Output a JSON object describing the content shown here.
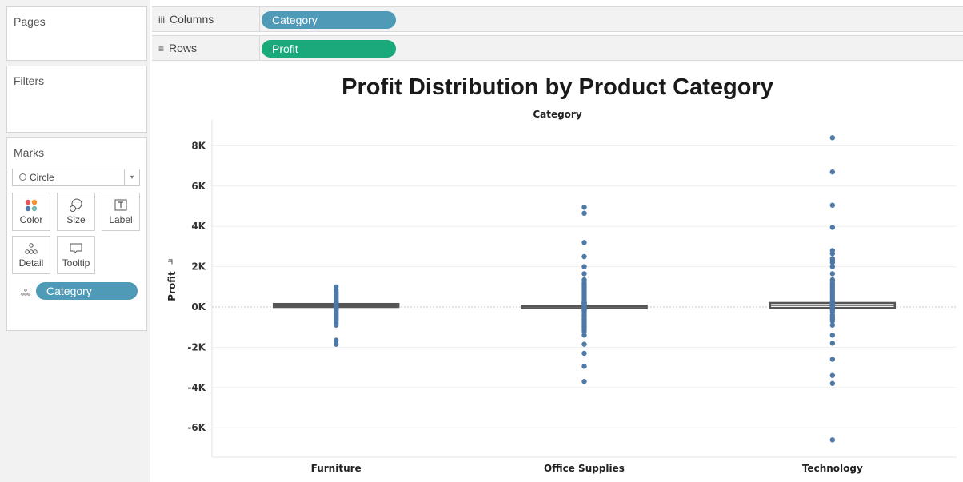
{
  "shelves": {
    "pages": "Pages",
    "filters": "Filters",
    "columns_label": "Columns",
    "rows_label": "Rows",
    "columns_pill": "Category",
    "rows_pill": "Profit",
    "columns_icon": "columns-icon",
    "rows_icon": "rows-icon"
  },
  "marks": {
    "title": "Marks",
    "type": "Circle",
    "buttons": {
      "color": "Color",
      "size": "Size",
      "label": "Label",
      "detail": "Detail",
      "tooltip": "Tooltip"
    },
    "detail_pill": "Category"
  },
  "colors": {
    "dimension_pill": "#4e9ab7",
    "measure_pill": "#1aa97a",
    "dot": "#4e79a7",
    "box": "#555555"
  },
  "chart_data": {
    "type": "scatter",
    "title": "Profit Distribution by Product Category",
    "column_header": "Category",
    "ylabel": "Profit",
    "categories": [
      "Furniture",
      "Office Supplies",
      "Technology"
    ],
    "yticks": [
      8000,
      6000,
      4000,
      2000,
      0,
      -2000,
      -4000,
      -6000
    ],
    "ytick_labels": [
      "8K",
      "6K",
      "4K",
      "2K",
      "0K",
      "-2K",
      "-4K",
      "-6K"
    ],
    "ylim": [
      -7500,
      8500
    ],
    "grid": true,
    "box": [
      {
        "category": "Furniture",
        "q1": 0,
        "median": 50,
        "q3": 150
      },
      {
        "category": "Office Supplies",
        "q1": 0,
        "median": 20,
        "q3": 60
      },
      {
        "category": "Technology",
        "q1": -50,
        "median": 80,
        "q3": 200
      }
    ],
    "points": [
      {
        "category": "Furniture",
        "y": [
          1000,
          850,
          750,
          700,
          650,
          600,
          550,
          500,
          450,
          400,
          350,
          300,
          250,
          -150,
          -200,
          -250,
          -300,
          -350,
          -400,
          -450,
          -500,
          -550,
          -600,
          -650,
          -700,
          -800,
          -900,
          -1650,
          -1850
        ]
      },
      {
        "category": "Office Supplies",
        "y": [
          4950,
          4650,
          3200,
          2500,
          2000,
          1650,
          1350,
          1200,
          1100,
          1000,
          900,
          800,
          700,
          600,
          500,
          400,
          300,
          200,
          -200,
          -300,
          -400,
          -500,
          -600,
          -700,
          -800,
          -900,
          -1000,
          -1100,
          -1200,
          -1400,
          -1850,
          -2300,
          -2950,
          -3700
        ]
      },
      {
        "category": "Technology",
        "y": [
          8400,
          6700,
          5050,
          3950,
          2800,
          2650,
          2400,
          2300,
          2200,
          2000,
          1650,
          1350,
          1200,
          1100,
          1000,
          900,
          800,
          700,
          600,
          500,
          400,
          300,
          -250,
          -400,
          -500,
          -600,
          -700,
          -900,
          -1400,
          -1800,
          -2600,
          -3400,
          -3800,
          -6600
        ]
      }
    ]
  }
}
